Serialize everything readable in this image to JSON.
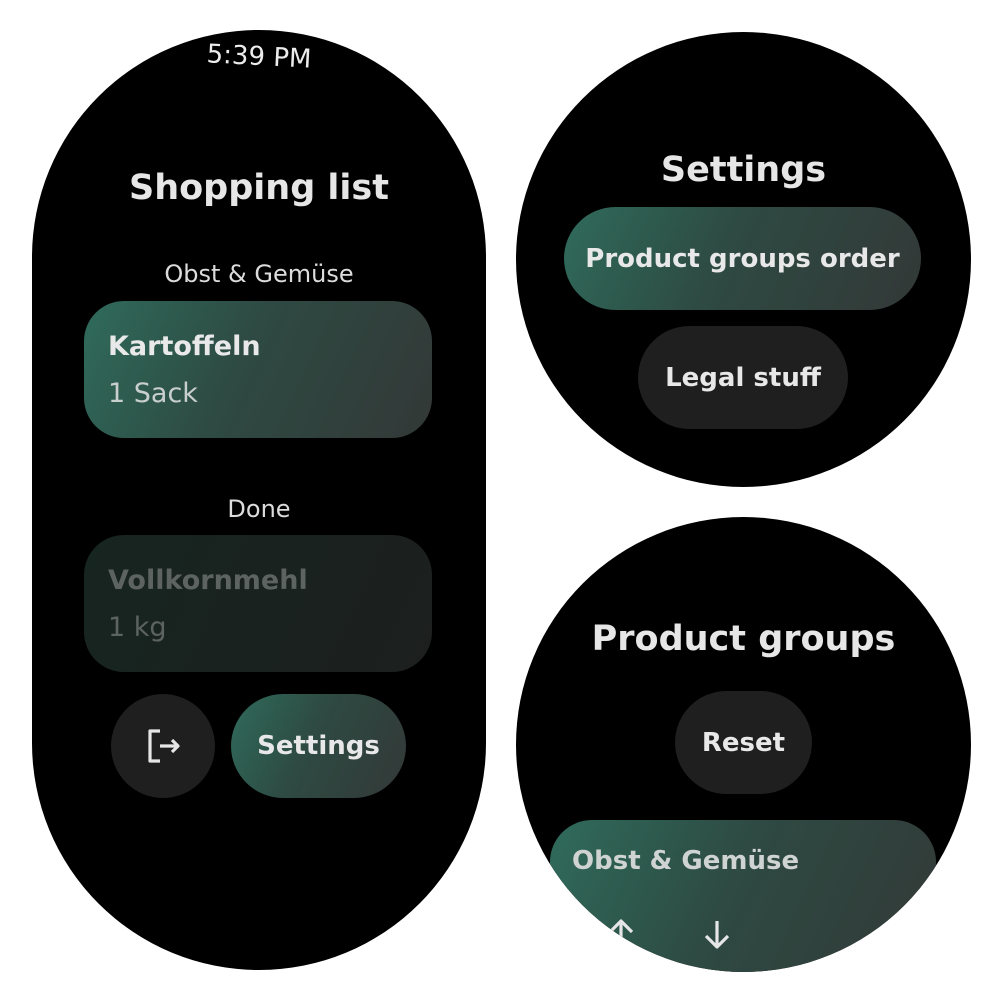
{
  "list_screen": {
    "clock": "5:39 PM",
    "title": "Shopping list",
    "group_header": "Obst & Gemüse",
    "active_item": {
      "name": "Kartoffeln",
      "quantity": "1 Sack"
    },
    "done_header": "Done",
    "done_item": {
      "name": "Vollkornmehl",
      "quantity": "1 kg"
    },
    "logout_icon": "logout-icon",
    "settings_button": "Settings"
  },
  "settings_screen": {
    "title": "Settings",
    "product_groups_order_button": "Product groups order",
    "legal_button": "Legal stuff"
  },
  "groups_screen": {
    "title": "Product groups",
    "reset_button": "Reset",
    "group_card": {
      "label": "Obst & Gemüse",
      "up_icon": "arrow-up-icon",
      "down_icon": "arrow-down-icon"
    }
  },
  "colors": {
    "accent_green": "#2f6b5b",
    "chip_dark": "#1f1f1f",
    "background": "#000000"
  }
}
